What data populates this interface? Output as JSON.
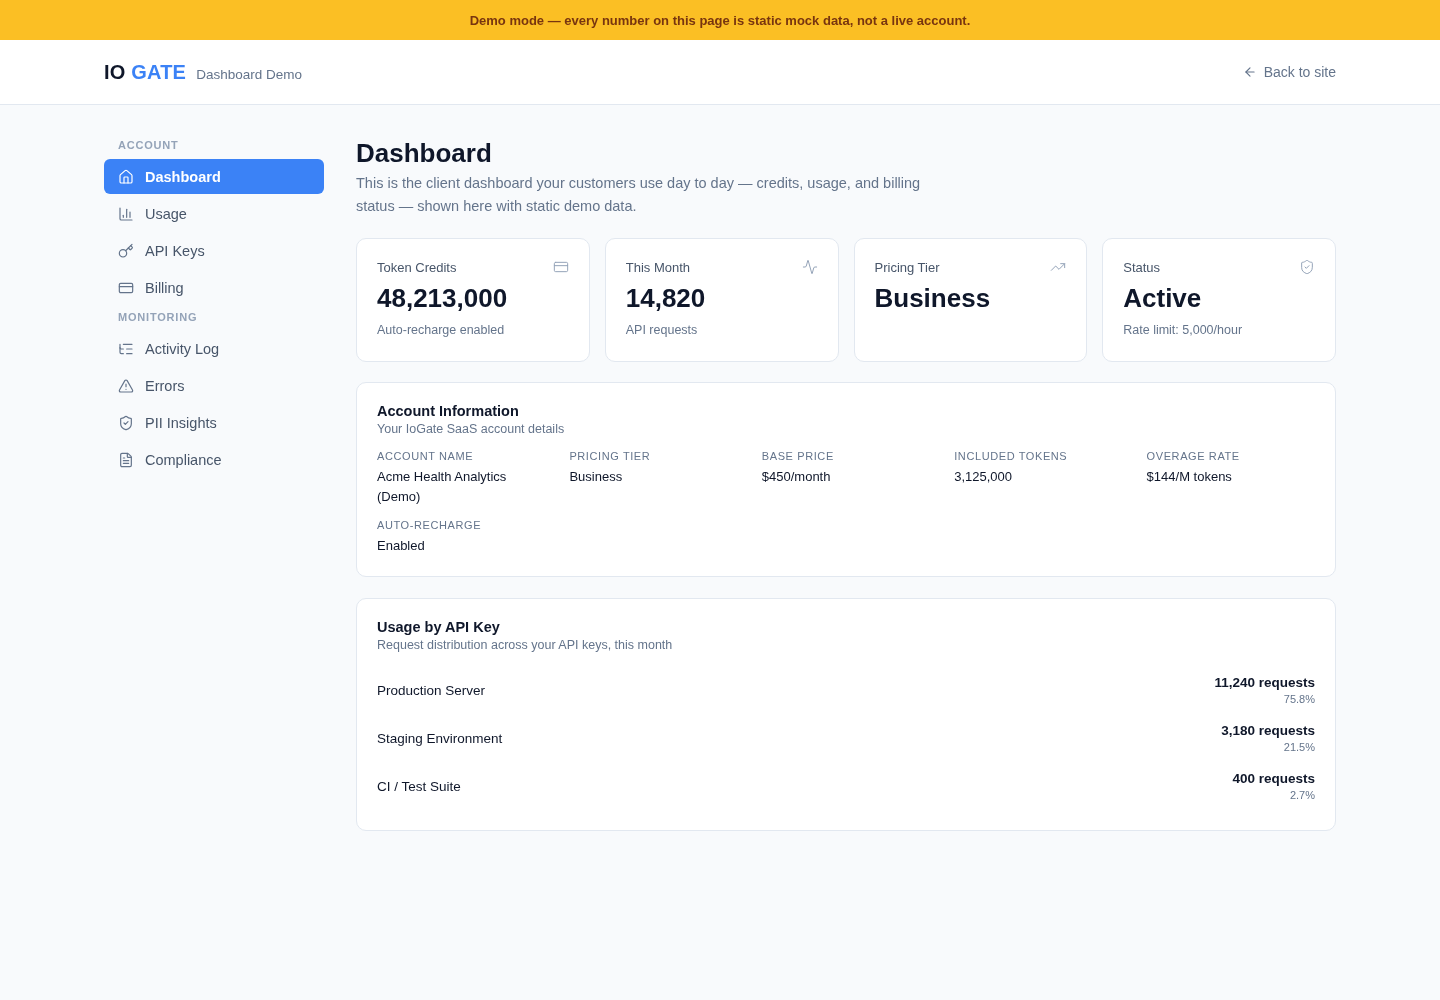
{
  "banner": {
    "text": "Demo mode — every number on this page is static mock data, not a live account."
  },
  "header": {
    "logo": {
      "text": "IO",
      "accent": "GATE"
    },
    "subtitle": "Dashboard Demo",
    "back_link": "Back to site"
  },
  "sidebar": {
    "sections": [
      {
        "title": "ACCOUNT",
        "items": [
          {
            "label": "Dashboard",
            "selected": true
          },
          {
            "label": "Usage",
            "selected": false
          },
          {
            "label": "API Keys",
            "selected": false
          },
          {
            "label": "Billing",
            "selected": false
          }
        ]
      },
      {
        "title": "MONITORING",
        "items": [
          {
            "label": "Activity Log",
            "selected": false
          },
          {
            "label": "Errors",
            "selected": false
          },
          {
            "label": "PII Insights",
            "selected": false
          },
          {
            "label": "Compliance",
            "selected": false
          }
        ]
      }
    ]
  },
  "page": {
    "title": "Dashboard",
    "description": "This is the client dashboard your customers use day to day — credits, usage, and billing status — shown here with static demo data."
  },
  "stats": [
    {
      "label": "Token Credits",
      "value": "48,213,000",
      "note": "Auto-recharge enabled"
    },
    {
      "label": "This Month",
      "value": "14,820",
      "note": "API requests"
    },
    {
      "label": "Pricing Tier",
      "value": "Business"
    },
    {
      "label": "Status",
      "value": "Active",
      "note": "Rate limit: 5,000/hour"
    }
  ],
  "account_info": {
    "title": "Account Information",
    "subtitle": "Your IoGate SaaS account details",
    "fields": [
      {
        "label": "ACCOUNT NAME",
        "value": "Acme Health Analytics (Demo)"
      },
      {
        "label": "PRICING TIER",
        "value": "Business"
      },
      {
        "label": "BASE PRICE",
        "value": "$450/month"
      },
      {
        "label": "INCLUDED TOKENS",
        "value": "3,125,000"
      },
      {
        "label": "OVERAGE RATE",
        "value": "$144/M tokens"
      },
      {
        "label": "AUTO-RECHARGE",
        "value": "Enabled"
      }
    ]
  },
  "usage": {
    "title": "Usage by API Key",
    "subtitle": "Request distribution across your API keys, this month",
    "rows": [
      {
        "name": "Production Server",
        "requests": "11,240 requests",
        "share": "75.8%"
      },
      {
        "name": "Staging Environment",
        "requests": "3,180 requests",
        "share": "21.5%"
      },
      {
        "name": "CI / Test Suite",
        "requests": "400 requests",
        "share": "2.7%"
      }
    ]
  }
}
